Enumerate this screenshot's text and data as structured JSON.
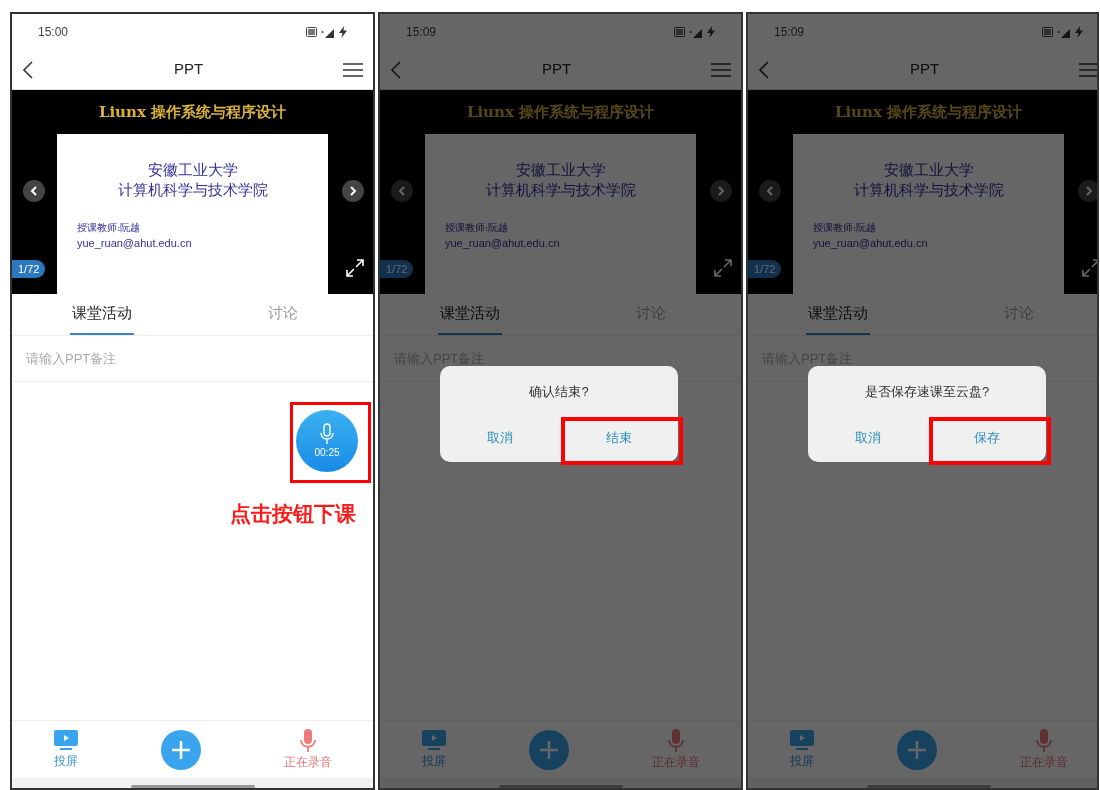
{
  "screens": [
    {
      "time": "15:00",
      "title": "PPT",
      "slide": {
        "heading": "Liunx 操作系统与程序设计",
        "lines": [
          "安徽工业大学",
          "计算机科学与技术学院"
        ],
        "teacher": "授课教师:阮越",
        "email": "yue_ruan@ahut.edu.cn"
      },
      "page_counter": "1/72",
      "tabs": [
        {
          "label": "课堂活动",
          "selected": true
        },
        {
          "label": "讨论",
          "selected": false
        }
      ],
      "note_placeholder": "请输入PPT备注",
      "record_button": {
        "time": "00:25",
        "highlighted": true
      },
      "bottom_nav": [
        {
          "kind": "cast",
          "label": "投屏"
        },
        {
          "kind": "add"
        },
        {
          "kind": "record",
          "label": "正在录音"
        }
      ],
      "caption": "点击按钮下课"
    },
    {
      "time": "15:09",
      "title": "PPT",
      "slide": {
        "heading": "Liunx 操作系统与程序设计",
        "lines": [
          "安徽工业大学",
          "计算机科学与技术学院"
        ],
        "teacher": "授课教师:阮越",
        "email": "yue_ruan@ahut.edu.cn"
      },
      "page_counter": "1/72",
      "tabs": [
        {
          "label": "课堂活动",
          "selected": true
        },
        {
          "label": "讨论",
          "selected": false
        }
      ],
      "note_placeholder": "请输入PPT备注",
      "bottom_nav": [
        {
          "kind": "cast",
          "label": "投屏"
        },
        {
          "kind": "add"
        },
        {
          "kind": "record",
          "label": "正在录音"
        }
      ],
      "dialog": {
        "message": "确认结束?",
        "buttons": [
          {
            "label": "取消",
            "highlighted": false
          },
          {
            "label": "结束",
            "highlighted": true
          }
        ]
      }
    },
    {
      "time": "15:09",
      "title": "PPT",
      "slide": {
        "heading": "Liunx 操作系统与程序设计",
        "lines": [
          "安徽工业大学",
          "计算机科学与技术学院"
        ],
        "teacher": "授课教师:阮越",
        "email": "yue_ruan@ahut.edu.cn"
      },
      "page_counter": "1/72",
      "tabs": [
        {
          "label": "课堂活动",
          "selected": true
        },
        {
          "label": "讨论",
          "selected": false
        }
      ],
      "note_placeholder": "请输入PPT备注",
      "bottom_nav": [
        {
          "kind": "cast",
          "label": "投屏"
        },
        {
          "kind": "add"
        },
        {
          "kind": "record",
          "label": "正在录音"
        }
      ],
      "dialog": {
        "message": "是否保存速课至云盘?",
        "buttons": [
          {
            "label": "取消",
            "highlighted": false
          },
          {
            "label": "保存",
            "highlighted": true
          }
        ]
      }
    }
  ]
}
